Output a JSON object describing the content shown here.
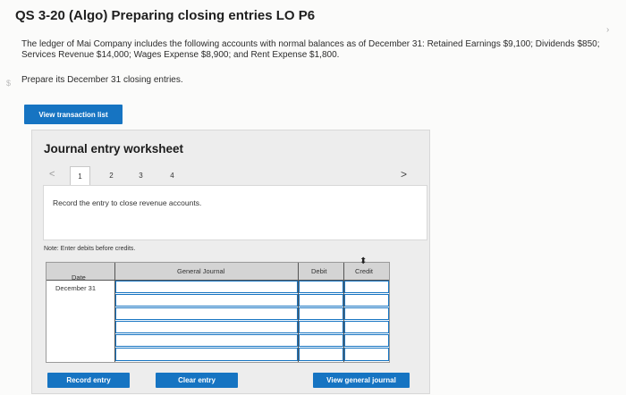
{
  "header": {
    "title": "QS 3-20 (Algo) Preparing closing entries LO P6"
  },
  "problem": {
    "text": "The ledger of Mai Company includes the following accounts with normal balances as of December 31: Retained Earnings $9,100; Dividends $850; Services Revenue $14,000; Wages Expense $8,900; and Rent Expense $1,800.",
    "prompt": "Prepare its December 31 closing entries."
  },
  "buttons": {
    "view_transaction_list": "View transaction list",
    "record_entry": "Record entry",
    "clear_entry": "Clear entry",
    "view_general_journal": "View general journal"
  },
  "worksheet": {
    "title": "Journal entry worksheet",
    "tabs": [
      "1",
      "2",
      "3",
      "4"
    ],
    "active_tab": "1",
    "instruction": "Record the entry to close revenue accounts.",
    "note": "Note: Enter debits before credits."
  },
  "journal": {
    "columns": {
      "date": "Date",
      "general_journal": "General Journal",
      "debit": "Debit",
      "credit": "Credit"
    },
    "date_value": "December 31",
    "row_count": 6
  },
  "colors": {
    "accent": "#1674c2",
    "panel_bg": "#ededed",
    "header_bg": "#d4d4d4"
  },
  "icons": {
    "prev": "chevron-left-icon",
    "next": "chevron-right-icon"
  }
}
